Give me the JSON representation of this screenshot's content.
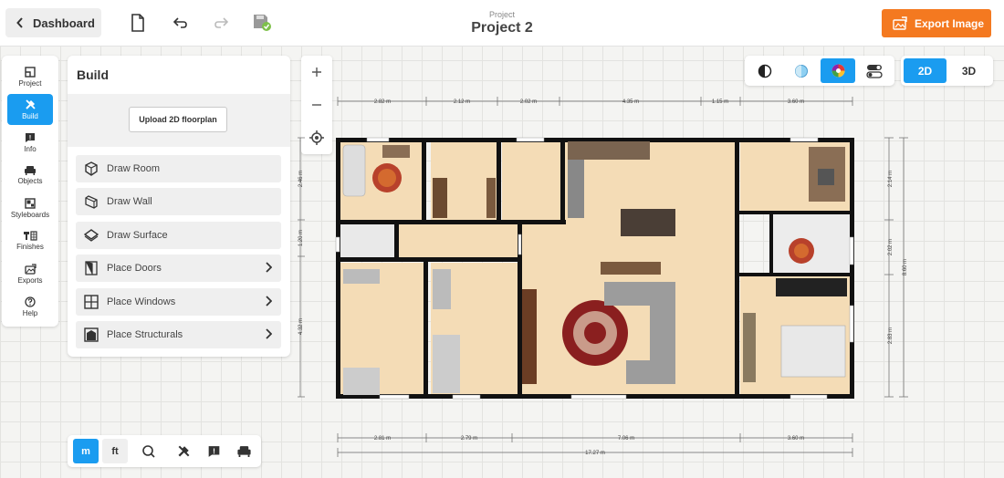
{
  "topbar": {
    "dashboard_label": "Dashboard",
    "project_label": "Project",
    "project_title": "Project 2",
    "export_label": "Export Image",
    "icons": [
      "new-file-icon",
      "undo-icon",
      "redo-icon",
      "save-icon"
    ],
    "accent_color": "#1a9cf0",
    "export_color": "#f47920"
  },
  "leftnav": {
    "items": [
      {
        "label": "Project",
        "icon": "project-icon"
      },
      {
        "label": "Build",
        "icon": "tools-icon",
        "active": true
      },
      {
        "label": "Info",
        "icon": "info-icon"
      },
      {
        "label": "Objects",
        "icon": "sofa-icon"
      },
      {
        "label": "Styleboards",
        "icon": "styleboard-icon"
      },
      {
        "label": "Finishes",
        "icon": "finishes-icon"
      },
      {
        "label": "Exports",
        "icon": "export-icon"
      },
      {
        "label": "Help",
        "icon": "help-icon"
      }
    ]
  },
  "build": {
    "title": "Build",
    "upload_label": "Upload 2D floorplan",
    "items": [
      {
        "label": "Draw Room",
        "icon": "cube-icon"
      },
      {
        "label": "Draw Wall",
        "icon": "wall-icon"
      },
      {
        "label": "Draw Surface",
        "icon": "surface-icon"
      },
      {
        "label": "Place Doors",
        "icon": "door-icon",
        "chevron": true
      },
      {
        "label": "Place Windows",
        "icon": "window-icon",
        "chevron": true
      },
      {
        "label": "Place Structurals",
        "icon": "structural-icon",
        "chevron": true
      }
    ]
  },
  "zoom": {
    "in": "zoom-in-icon",
    "out": "zoom-out-icon",
    "center": "locate-icon"
  },
  "view": {
    "modes": [
      "contrast-icon",
      "shading-icon",
      "color-icon",
      "toggle-icon"
    ],
    "active_mode": 2,
    "dim_2d": "2D",
    "dim_3d": "3D",
    "active_dim": "2D"
  },
  "bottombar": {
    "unit_m": "m",
    "unit_ft": "ft",
    "active_unit": "m",
    "icons": [
      "search-icon",
      "tools-icon",
      "comment-icon",
      "sofa-icon"
    ]
  },
  "plan": {
    "top_dims": [
      "2.82 m",
      "2.12 m",
      "2.02 m",
      "4.35 m",
      "1.15 m",
      "3.60 m"
    ],
    "bottom_dims": [
      "2.81 m",
      "2.79 m",
      "7.06 m",
      "3.60 m"
    ],
    "total_dim": "17.27 m",
    "left_dims": [
      "2.46 m",
      "1.20 m",
      "4.32 m"
    ],
    "right_dims": [
      "2.14 m",
      "2.02 m",
      "2.83 m"
    ],
    "right_total": "8.60 m"
  }
}
